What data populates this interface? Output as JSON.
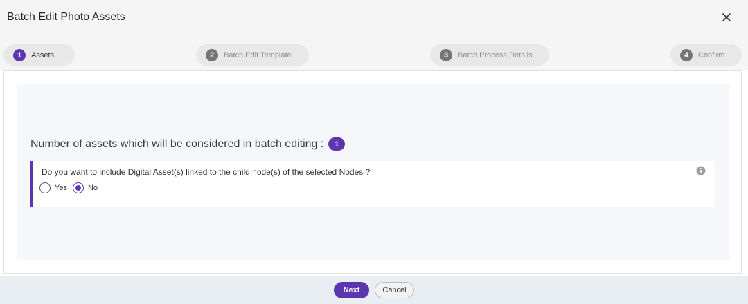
{
  "dialog": {
    "title": "Batch Edit Photo Assets"
  },
  "steps": [
    {
      "number": "1",
      "label": "Assets",
      "active": true
    },
    {
      "number": "2",
      "label": "Batch Edit Template",
      "active": false
    },
    {
      "number": "3",
      "label": "Batch Process Details",
      "active": false
    },
    {
      "number": "4",
      "label": "Confirm",
      "active": false
    }
  ],
  "main": {
    "heading": "Number of assets which will be considered in batch editing :",
    "asset_count": "1",
    "question": "Do you want to include Digital Asset(s) linked to the child node(s) of the selected Nodes ?",
    "options": [
      {
        "label": "Yes",
        "selected": false
      },
      {
        "label": "No",
        "selected": true
      }
    ]
  },
  "footer": {
    "next_label": "Next",
    "cancel_label": "Cancel"
  },
  "colors": {
    "accent": "#5e35b1",
    "inactive_step": "#757575",
    "panel_bg": "#f5f7fa"
  },
  "icons": {
    "close": "close-icon",
    "info": "info-icon"
  }
}
